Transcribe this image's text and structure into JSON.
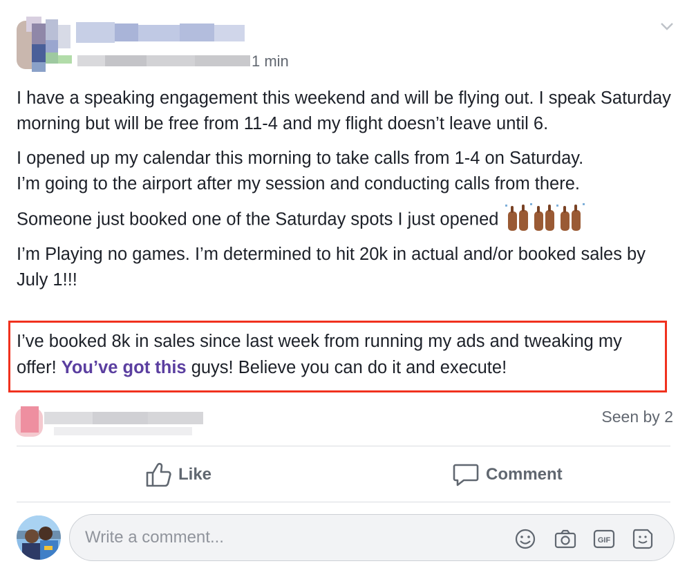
{
  "post": {
    "timestamp": "1 min",
    "paragraphs": [
      "I have a speaking engagement this weekend and will be flying out. I speak Saturday morning but will be free from 11-4 and my flight doesn’t leave until 6.",
      "I opened up my calendar this morning to take calls from 1-4 on Saturday.",
      "I’m going to the airport after my session and conducting calls from there.",
      "Someone just booked one of the Saturday spots I just opened",
      "I’m Playing no games. I’m determined to hit 20k in actual and/or booked sales by July 1!!!"
    ],
    "highlighted": {
      "before": "I’ve booked 8k in sales since last week from running my ads and tweaking my offer! ",
      "mention": "You’ve got this",
      "after": " guys! Believe you can do it and execute!"
    },
    "seen_by": "Seen by 2"
  },
  "actions": {
    "like_label": "Like",
    "comment_label": "Comment"
  },
  "composer": {
    "placeholder": "Write a comment..."
  },
  "icons": [
    "chevron-down-icon",
    "raised-hands-emoji",
    "like-thumb-icon",
    "comment-bubble-icon",
    "smiley-icon",
    "camera-icon",
    "gif-icon",
    "sticker-icon"
  ],
  "colors": {
    "highlight_border": "#f0311e",
    "mention": "#5b3fa0",
    "secondary_text": "#616770",
    "action_text": "#606770"
  }
}
